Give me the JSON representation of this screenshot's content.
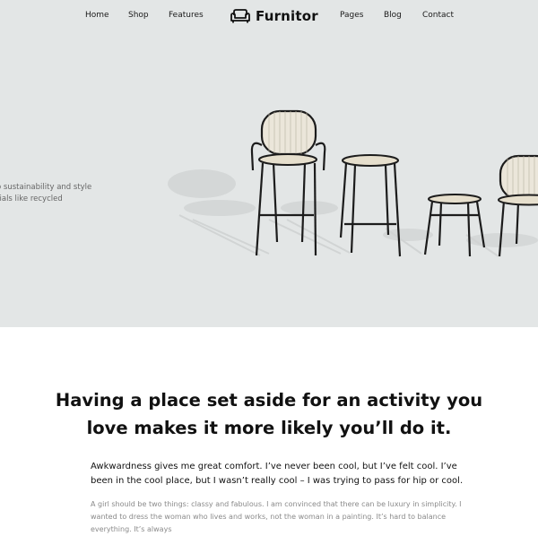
{
  "nav": {
    "left": [
      "Home",
      "Shop",
      "Features"
    ],
    "right": [
      "Pages",
      "Blog",
      "Contact"
    ],
    "brand": "Furnitor",
    "brand_icon": "sofa-icon"
  },
  "hero": {
    "text_line1": "o sustainability and style",
    "text_line2": "rials like recycled",
    "background": "#e3e6e6"
  },
  "content": {
    "headline_line1": "Having a place set aside for an activity you",
    "headline_line2": "love makes it more likely you’ll do it.",
    "intro": "Awkwardness gives me great comfort. I’ve never been cool, but I’ve felt cool. I’ve been in the cool place, but I wasn’t really cool – I was trying to pass for hip or cool.",
    "body": "A girl should be two things: classy and fabulous. I am convinced that there can be luxury in simplicity. I wanted to dress the woman who lives and works, not the woman in a painting. It’s hard to balance everything. It’s always"
  }
}
